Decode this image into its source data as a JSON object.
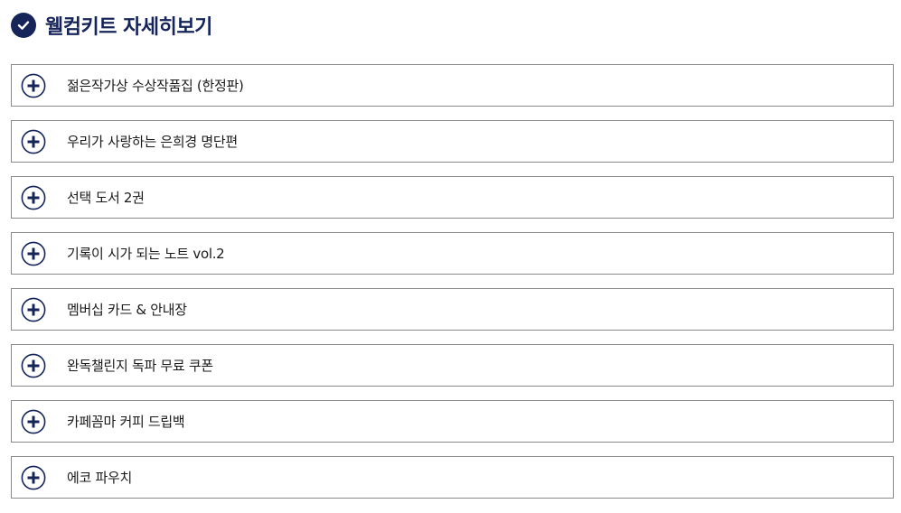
{
  "header": {
    "title": "웰컴키트 자세히보기",
    "icon": "check-circle-icon"
  },
  "items": [
    {
      "label": "젊은작가상 수상작품집 (한정판)",
      "icon": "plus-circle-icon"
    },
    {
      "label": "우리가 사랑하는 은희경 명단편",
      "icon": "plus-circle-icon"
    },
    {
      "label": "선택 도서 2권",
      "icon": "plus-circle-icon"
    },
    {
      "label": "기록이 시가 되는 노트 vol.2",
      "icon": "plus-circle-icon"
    },
    {
      "label": "멤버십 카드 & 안내장",
      "icon": "plus-circle-icon"
    },
    {
      "label": "완독챌린지 독파 무료 쿠폰",
      "icon": "plus-circle-icon"
    },
    {
      "label": "카페꼼마 커피 드립백",
      "icon": "plus-circle-icon"
    },
    {
      "label": "에코 파우치",
      "icon": "plus-circle-icon"
    }
  ],
  "colors": {
    "accent": "#16245a",
    "border": "#8a8a8a",
    "text": "#1a1a1a"
  }
}
